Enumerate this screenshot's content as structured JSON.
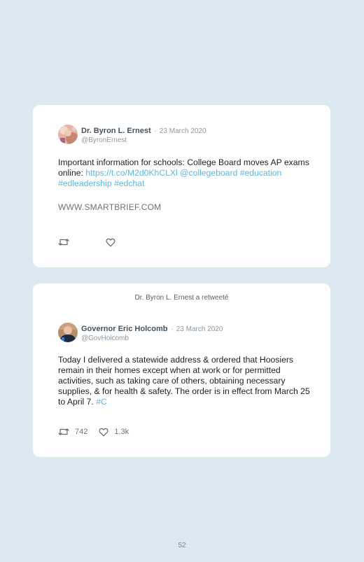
{
  "tweet1": {
    "author_name": "Dr. Byron L. Ernest",
    "separator": "·",
    "date": "23 March 2020",
    "handle": "@ByronErnest",
    "text_prefix": "Important information for schools: College Board moves AP exams online: ",
    "link_url": "https://t.co/M2d0KhCLXl",
    "mention": "@collegeboard",
    "hashtags": "#education #edleadership #edchat",
    "site": "WWW.SMARTBRIEF.COM"
  },
  "tweet2": {
    "retweet_notice": "Dr. Byron L. Ernest a retweeté",
    "author_name": "Governor Eric Holcomb",
    "separator": "·",
    "date": "23 March 2020",
    "handle": "@GovHolcomb",
    "text": "Today I delivered a statewide address & ordered that Hoosiers remain in their homes except when at work or for permitted activities, such as taking care of others, obtaining necessary supplies, & for health & safety. The order is in effect from March 25 to April 7. ",
    "trailing_link": "#C",
    "retweet_count": "742",
    "like_count": "1.3k"
  },
  "icons": {
    "retweet": "retweet-icon",
    "like": "heart-icon"
  },
  "colors": {
    "background": "#dde9f1",
    "link": "#5bb6e6"
  },
  "page_number": "52"
}
